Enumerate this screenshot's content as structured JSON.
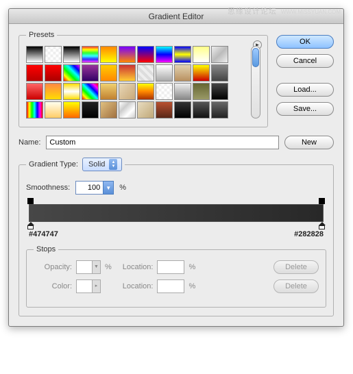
{
  "watermark": {
    "text": "思缘设计论坛",
    "url": "WWW.MISSYUAN.COM"
  },
  "titlebar": "Gradient Editor",
  "presets": {
    "legend": "Presets",
    "swatches": [
      "linear-gradient(#000,#fff)",
      "repeating-conic-gradient(#eee 0 25%,#fff 0 50%) 50%/8px 8px",
      "linear-gradient(#000,#fff)",
      "linear-gradient(#f33,#ff0,#3f3,#3ff,#33f,#f3f)",
      "linear-gradient(#f80,#ff0)",
      "linear-gradient(#70f,#f80)",
      "linear-gradient(#00f,#f00)",
      "linear-gradient(#0ff,#00f,#f0f)",
      "linear-gradient(#00f,#ff0,#00f)",
      "linear-gradient(#ff8,#fff)",
      "linear-gradient(135deg,#eee,#bbb,#eee)",
      "linear-gradient(#f00,#b00)",
      "linear-gradient(#f00,#a00)",
      "linear-gradient(45deg,#f00,#ff0,#0f0,#0ff,#00f,#f0f)",
      "linear-gradient(#939,#306)",
      "linear-gradient(#fc0,#f80)",
      "linear-gradient(#c33,#fc3)",
      "repeating-linear-gradient(45deg,#eee 0 4px,#ddd 4px 8px)",
      "linear-gradient(#fff,#aaa)",
      "linear-gradient(#e2d2b0,#b89060)",
      "linear-gradient(#ff0,#c00)",
      "linear-gradient(#888,#444)",
      "linear-gradient(#f66,#c00)",
      "linear-gradient(#f84,#fd0)",
      "linear-gradient(#fd0,#fff,#fd0)",
      "linear-gradient(45deg,#f00,#ff0,#0f0,#0ff,#00f,#f0f,#f00)",
      "linear-gradient(#f0d070,#c08030)",
      "linear-gradient(135deg,#e8d8b8,#c8a878)",
      "linear-gradient(#ff0,#f80,#a30)",
      "repeating-conic-gradient(#eee 0 25%,#fff 0 50%) 50%/8px 8px",
      "linear-gradient(#eee,#888)",
      "linear-gradient(#663,#996)",
      "linear-gradient(#444,#000)",
      "linear-gradient(90deg,#f00,#ff0,#0f0,#0ff,#00f,#f0f,#f00)",
      "linear-gradient(#ffe,#fc6)",
      "linear-gradient(#ff0,#f60)",
      "linear-gradient(#222,#000)",
      "linear-gradient(135deg,#e0c080,#a07040)",
      "linear-gradient(135deg,#fff,#ccc,#fff,#ccc)",
      "linear-gradient(135deg,#e8dcc0,#c0a878)",
      "linear-gradient(#b85030,#5a2818)",
      "linear-gradient(#333,#000)",
      "linear-gradient(#555,#111)",
      "linear-gradient(#666,#222)"
    ]
  },
  "buttons": {
    "ok": "OK",
    "cancel": "Cancel",
    "load": "Load...",
    "save": "Save...",
    "new": "New",
    "delete": "Delete"
  },
  "name": {
    "label": "Name:",
    "value": "Custom"
  },
  "gradient": {
    "type_label": "Gradient Type:",
    "type_value": "Solid",
    "smooth_label": "Smoothness:",
    "smooth_value": "100",
    "pct": "%",
    "hex_left": "#474747",
    "hex_right": "#282828"
  },
  "stops": {
    "legend": "Stops",
    "opacity_label": "Opacity:",
    "color_label": "Color:",
    "location_label": "Location:",
    "opacity_value": "",
    "color_value": "",
    "loc1": "",
    "loc2": ""
  }
}
